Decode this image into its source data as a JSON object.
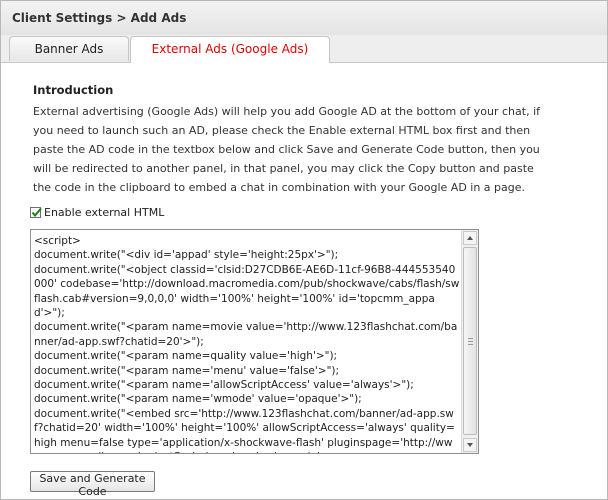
{
  "header": {
    "title": "Client Settings  > Add Ads"
  },
  "tabs": [
    {
      "label": "Banner Ads",
      "active": false
    },
    {
      "label": "External Ads (Google Ads)",
      "active": true
    }
  ],
  "intro": {
    "title": "Introduction",
    "text": "External advertising (Google Ads) will help you add Google AD at the bottom of your chat, if you need to launch such an AD, please check the Enable external HTML box first and then paste the AD code in the textbox below and click Save and Generate Code button, then you will be redirected to another panel, in that panel, you may click the Copy button and paste the code in the clipboard to embed a chat in combination with your Google AD in a page."
  },
  "enable_external": {
    "label": "Enable external HTML",
    "checked": true
  },
  "code_text": "<script>\ndocument.write(\"<div id='appad' style='height:25px'>\");\ndocument.write(\"<object classid='clsid:D27CDB6E-AE6D-11cf-96B8-444553540000' codebase='http://download.macromedia.com/pub/shockwave/cabs/flash/swflash.cab#version=9,0,0,0' width='100%' height='100%' id='topcmm_appad'>\");\ndocument.write(\"<param name=movie value='http://www.123flashchat.com/banner/ad-app.swf?chatid=20'>\");\ndocument.write(\"<param name=quality value='high'>\");\ndocument.write(\"<param name='menu' value='false'>\");\ndocument.write(\"<param name='allowScriptAccess' value='always'>\");\ndocument.write(\"<param name='wmode' value='opaque'>\");\ndocument.write(\"<embed src='http://www.123flashchat.com/banner/ad-app.swf?chatid=20' width='100%' height='100%' allowScriptAccess='always' quality=high menu=false type='application/x-shockwave-flash' pluginspage='http://www.macromedia.com/go/getflashplayer' scale='noscale'",
  "save_button": {
    "label": "Save and Generate Code"
  },
  "colors": {
    "active_tab_text": "#e00000",
    "header_bg": "#e8e8e8"
  },
  "icons": {
    "checkbox": "checkmark-icon",
    "scroll_up": "arrow-up-icon",
    "scroll_down": "arrow-down-icon"
  }
}
